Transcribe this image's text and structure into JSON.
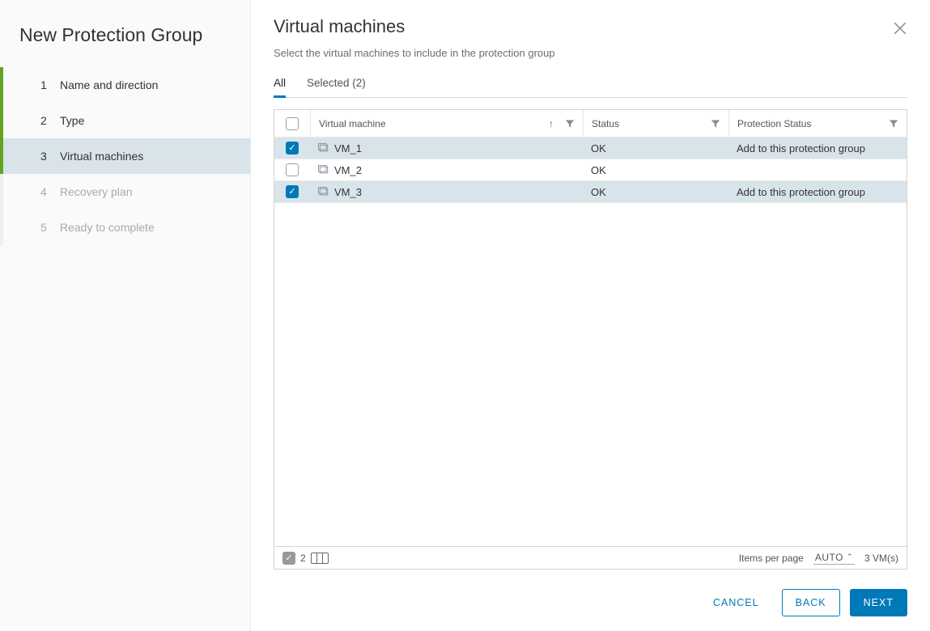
{
  "wizard": {
    "title": "New Protection Group",
    "steps": [
      {
        "num": "1",
        "label": "Name and direction",
        "state": "done"
      },
      {
        "num": "2",
        "label": "Type",
        "state": "done"
      },
      {
        "num": "3",
        "label": "Virtual machines",
        "state": "current"
      },
      {
        "num": "4",
        "label": "Recovery plan",
        "state": "future"
      },
      {
        "num": "5",
        "label": "Ready to complete",
        "state": "future"
      }
    ]
  },
  "pane": {
    "title": "Virtual machines",
    "description": "Select the virtual machines to include in the protection group",
    "tabs": {
      "all": "All",
      "selected": "Selected (2)"
    }
  },
  "table": {
    "columns": {
      "vm": "Virtual machine",
      "status": "Status",
      "protection": "Protection Status"
    },
    "rows": [
      {
        "name": "VM_1",
        "status": "OK",
        "protection": "Add to this protection group",
        "checked": true
      },
      {
        "name": "VM_2",
        "status": "OK",
        "protection": "",
        "checked": false
      },
      {
        "name": "VM_3",
        "status": "OK",
        "protection": "Add to this protection group",
        "checked": true
      }
    ],
    "footer": {
      "selected_count": "2",
      "items_per_page_label": "Items per page",
      "items_per_page_value": "AUTO",
      "total": "3 VM(s)"
    }
  },
  "buttons": {
    "cancel": "Cancel",
    "back": "Back",
    "next": "Next"
  }
}
